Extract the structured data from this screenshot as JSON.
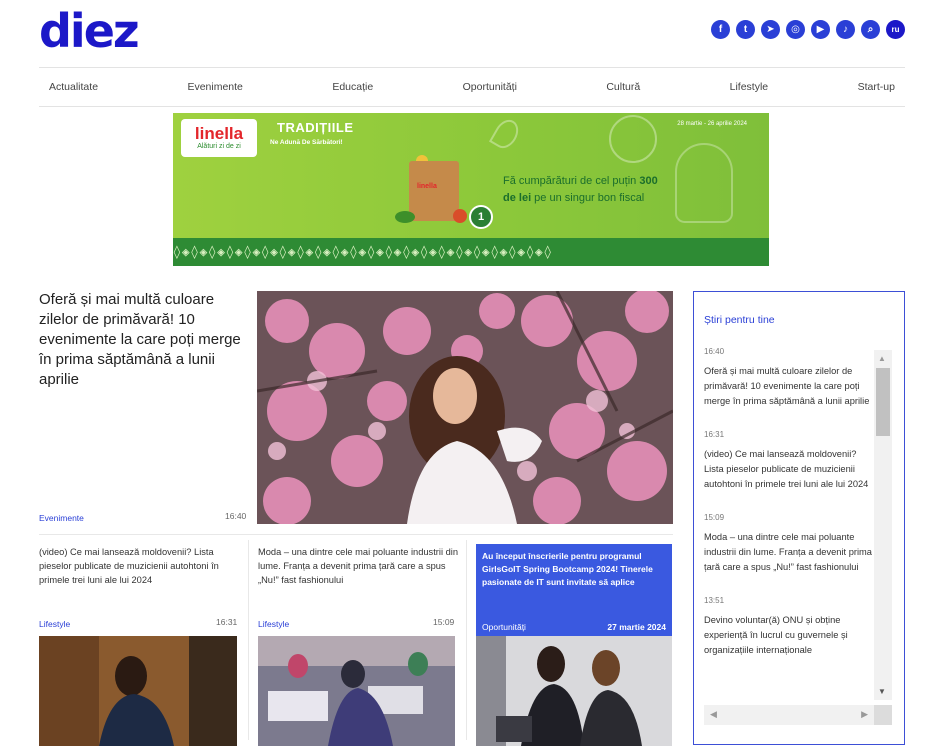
{
  "site": {
    "logo": "diez"
  },
  "social": [
    {
      "name": "facebook-icon",
      "glyph": "f"
    },
    {
      "name": "twitter-icon",
      "glyph": "t"
    },
    {
      "name": "telegram-icon",
      "glyph": "➤"
    },
    {
      "name": "instagram-icon",
      "glyph": "◎"
    },
    {
      "name": "youtube-icon",
      "glyph": "▶"
    },
    {
      "name": "tiktok-icon",
      "glyph": "♪"
    },
    {
      "name": "search-icon",
      "glyph": "⌕"
    },
    {
      "name": "language-switch",
      "glyph": "ru"
    }
  ],
  "nav": [
    "Actualitate",
    "Evenimente",
    "Educație",
    "Oportunități",
    "Cultură",
    "Lifestyle",
    "Start-up"
  ],
  "banner": {
    "brand": "linella",
    "brand_sub": "Alături zi de zi",
    "title": "TRADIȚIILE",
    "subtitle": "Ne Adună De Sărbători!",
    "date": "28 martie - 26 aprilie 2024",
    "bag_label": "linella",
    "badge": "1",
    "msg_pre": "Fă cumpărături de cel puțin ",
    "msg_amount": "300 de lei",
    "msg_post": " pe un singur bon fiscal",
    "pattern": "◊◈◊◈◊◈◊◈◊◈◊◈◊◈◊◈◊◈◊◈◊◈◊◈◊◈◊◈◊◈◊◈◊◈◊◈◊◈◊◈◊◈◊"
  },
  "lead": {
    "title": "Oferă și mai multă culoare zilelor de primăvară! 10 evenimente la care poți merge în prima săptămână a lunii aprilie",
    "category": "Evenimente",
    "time": "16:40"
  },
  "cards": [
    {
      "title": "(video) Ce mai lansează moldovenii? Lista pieselor publicate de muzicienii autohtoni în primele trei luni ale lui 2024",
      "category": "Lifestyle",
      "time": "16:31"
    },
    {
      "title": "Moda – una dintre cele mai poluante industrii din lume. Franța a devenit prima țară care a spus „Nu!” fast fashionului",
      "category": "Lifestyle",
      "time": "15:09"
    },
    {
      "title": "Au început înscrierile pentru programul GirlsGoIT Spring Bootcamp 2024! Tinerele pasionate de IT sunt invitate să aplice",
      "category": "Oportunități",
      "time": "27 martie 2024"
    }
  ],
  "sidebar": {
    "title": "Știri pentru tine",
    "items": [
      {
        "time": "16:40",
        "text": "Oferă și mai multă culoare zilelor de primăvară! 10 evenimente la care poți merge în prima săptămână a lunii aprilie"
      },
      {
        "time": "16:31",
        "text": "(video) Ce mai lansează moldovenii? Lista pieselor publicate de muzicienii autohtoni în primele trei luni ale lui 2024"
      },
      {
        "time": "15:09",
        "text": "Moda – una dintre cele mai poluante industrii din lume. Franța a devenit prima țară care a spus „Nu!” fast fashionului"
      },
      {
        "time": "13:51",
        "text": "Devino voluntar(ă) ONU și obține experiență în lucrul cu guvernele și organizațiile internaționale"
      }
    ]
  },
  "colors": {
    "brand": "#1c18c8",
    "accent": "#2a3fd6",
    "feature_bg": "#3a59e0",
    "banner_green": "#8cc83a"
  }
}
